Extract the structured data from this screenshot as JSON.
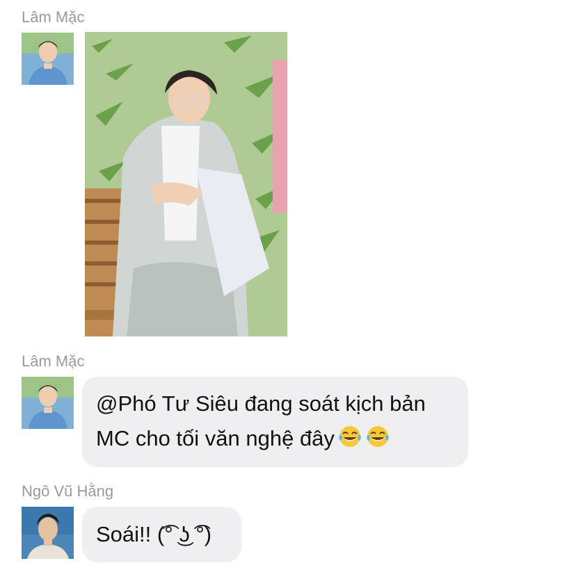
{
  "messages": [
    {
      "sender": "Lâm Mặc",
      "type": "image",
      "image_description": "photo-of-young-man-reading-script-on-bench"
    },
    {
      "sender": "Lâm Mặc",
      "type": "text",
      "lines": [
        "@Phó Tư Siêu đang soát kịch bản",
        "MC cho tối văn nghệ đây"
      ],
      "emojis": [
        "tears-of-joy-emoji",
        "tears-of-joy-emoji"
      ]
    },
    {
      "sender": "Ngô Vũ Hằng",
      "type": "text",
      "lines": [
        "Soái!! (͡° ͜ʖ ͡°)"
      ]
    }
  ],
  "colors": {
    "bubble_bg": "#efeff1",
    "sender_name": "#9a9a9e",
    "message_text": "#111111",
    "background": "#ffffff"
  }
}
